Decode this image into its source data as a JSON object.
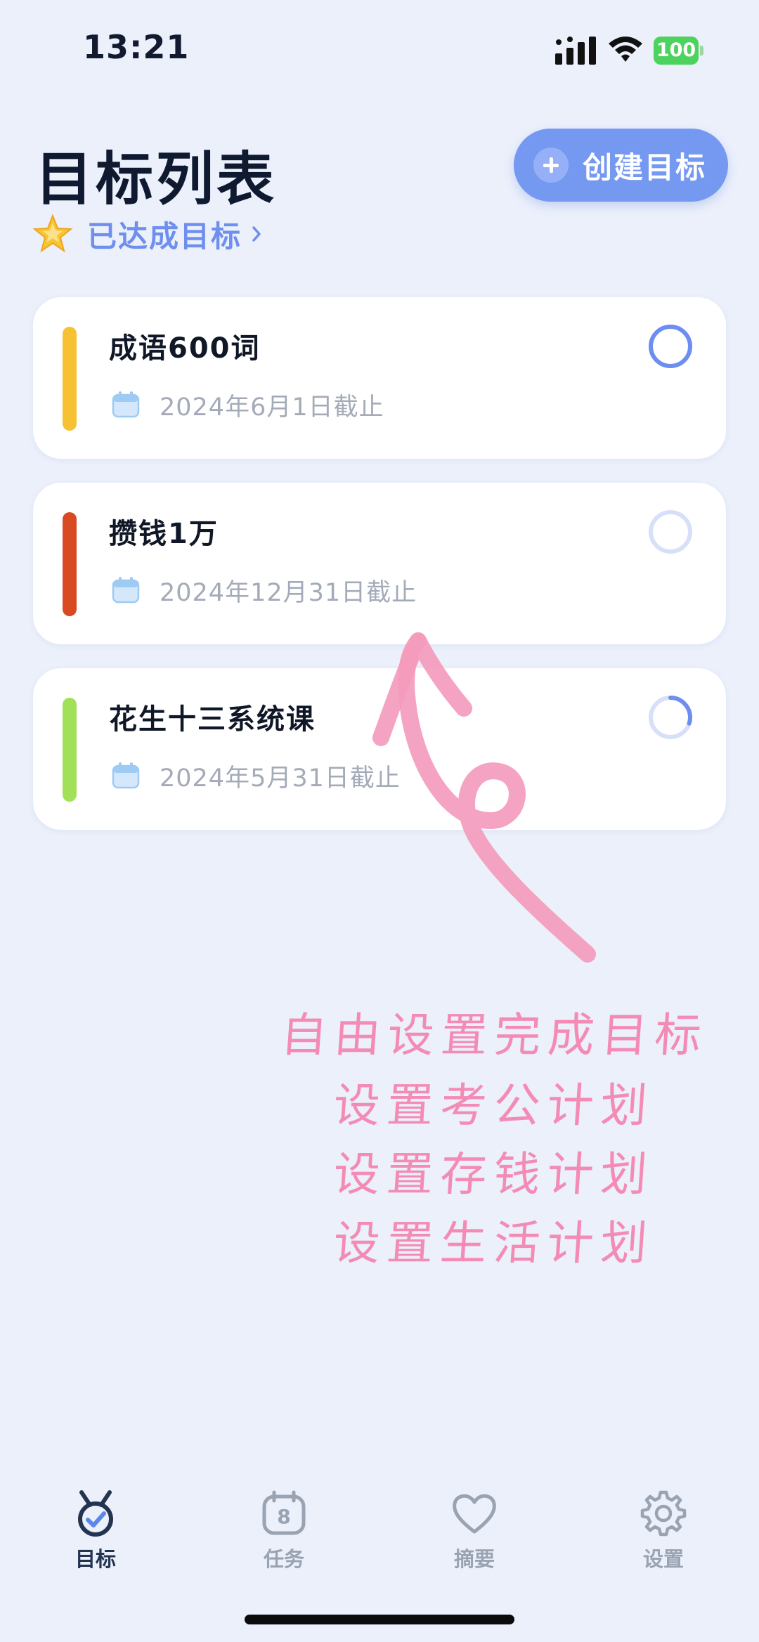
{
  "status_bar": {
    "time": "13:21",
    "battery": "100"
  },
  "header": {
    "title": "目标列表",
    "create_button_label": "创建目标",
    "achieved_link_label": "已达成目标"
  },
  "goals": [
    {
      "title": "成语600词",
      "deadline": "2024年6月1日截止",
      "color": "#f6c232",
      "progress": 1.0
    },
    {
      "title": "攒钱1万",
      "deadline": "2024年12月31日截止",
      "color": "#da4a22",
      "progress": 0.0
    },
    {
      "title": "花生十三系统课",
      "deadline": "2024年5月31日截止",
      "color": "#a3e059",
      "progress": 0.3
    }
  ],
  "annotation": {
    "lines": [
      "自由设置完成目标",
      "设置考公计划",
      "设置存钱计划",
      "设置生活计划"
    ],
    "color": "#f48bb5"
  },
  "tab_bar": {
    "active_color": "#233352",
    "inactive_color": "#9aa3b2",
    "tabs": [
      {
        "label": "目标",
        "icon": "medal-check-icon",
        "active": true
      },
      {
        "label": "任务",
        "icon": "calendar-8-icon",
        "active": false
      },
      {
        "label": "摘要",
        "icon": "heart-icon",
        "active": false
      },
      {
        "label": "设置",
        "icon": "gear-icon",
        "active": false
      }
    ]
  }
}
